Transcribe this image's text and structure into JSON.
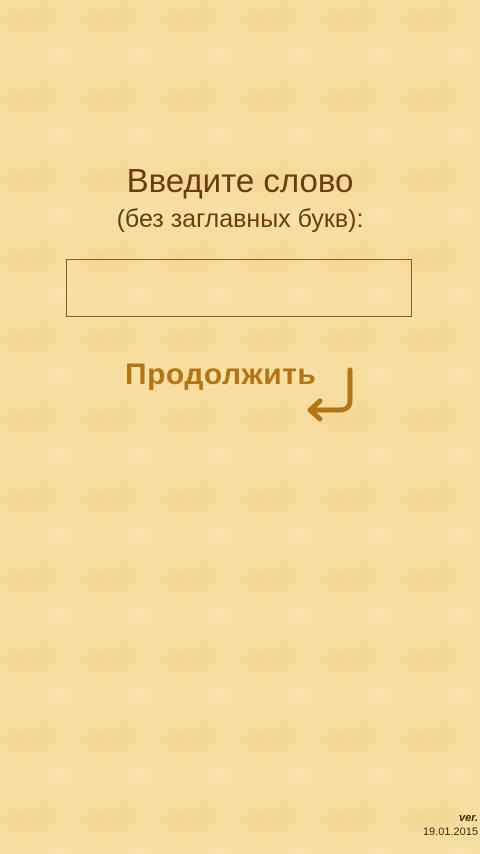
{
  "prompt": {
    "title": "Введите слово",
    "subtitle": "(без заглавных букв):"
  },
  "word_input": {
    "value": "",
    "placeholder": ""
  },
  "continue_button": {
    "label": "Продолжить",
    "icon": "enter-arrow-icon"
  },
  "version": {
    "label": "ver.",
    "date": "19.01.2015"
  },
  "colors": {
    "background": "#f7dea0",
    "text_dark": "#6b3c0c",
    "accent": "#b57514"
  }
}
